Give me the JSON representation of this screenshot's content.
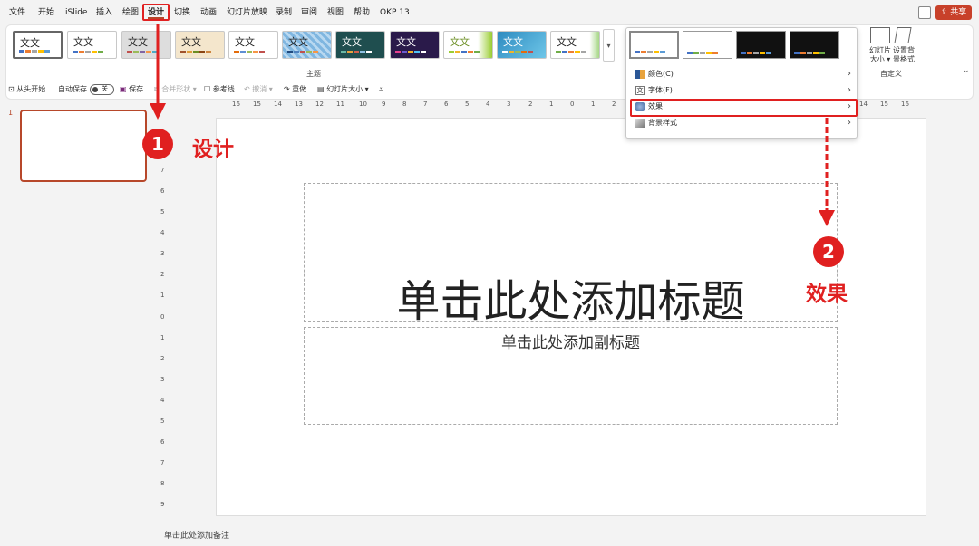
{
  "menubar": {
    "items": [
      "文件",
      "开始",
      "iSlide",
      "插入",
      "绘图",
      "设计",
      "切换",
      "动画",
      "幻灯片放映",
      "录制",
      "审阅",
      "视图",
      "帮助",
      "OKP 13"
    ],
    "active": "设计",
    "share_label": "共享"
  },
  "ribbon": {
    "theme_text": "文文",
    "themes_group_label": "主题",
    "customize_group_label": "自定义",
    "slide_size_label_1": "幻灯片",
    "slide_size_label_2": "大小",
    "bg_format_label_1": "设置背",
    "bg_format_label_2": "景格式"
  },
  "quick_access": {
    "from_start": "从头开始",
    "autosave": "自动保存",
    "toggle_state": "关",
    "save": "保存",
    "merge_shapes": "合并形状",
    "guides": "参考线",
    "undo": "撤消",
    "redo": "重做",
    "slide_size": "幻灯片大小"
  },
  "slide_panel": {
    "slide_number": "1"
  },
  "slide": {
    "title_placeholder": "单击此处添加标题",
    "subtitle_placeholder": "单击此处添加副标题"
  },
  "notes": {
    "placeholder": "单击此处添加备注"
  },
  "ruler": {
    "h_ticks": [
      "16",
      "15",
      "14",
      "13",
      "12",
      "11",
      "10",
      "9",
      "8",
      "7",
      "6",
      "5",
      "4",
      "3",
      "2",
      "1",
      "0",
      "1",
      "2",
      "14",
      "15",
      "16"
    ],
    "v_ticks": [
      "7",
      "6",
      "5",
      "4",
      "3",
      "2",
      "1",
      "0",
      "1",
      "2",
      "3",
      "4",
      "5",
      "6",
      "7",
      "8",
      "9"
    ]
  },
  "variants_menu": {
    "items": [
      {
        "label": "颜色(C)",
        "icon": "palette-icon"
      },
      {
        "label": "字体(F)",
        "icon": "font-icon"
      },
      {
        "label": "效果",
        "icon": "effects-icon"
      },
      {
        "label": "背景样式",
        "icon": "background-style-icon"
      }
    ]
  },
  "annotations": {
    "step1_number": "1",
    "step1_text": "设计",
    "step2_number": "2",
    "step2_text": "效果"
  },
  "colors": {
    "accent": "#b7472a",
    "annotation_red": "#e02020"
  }
}
